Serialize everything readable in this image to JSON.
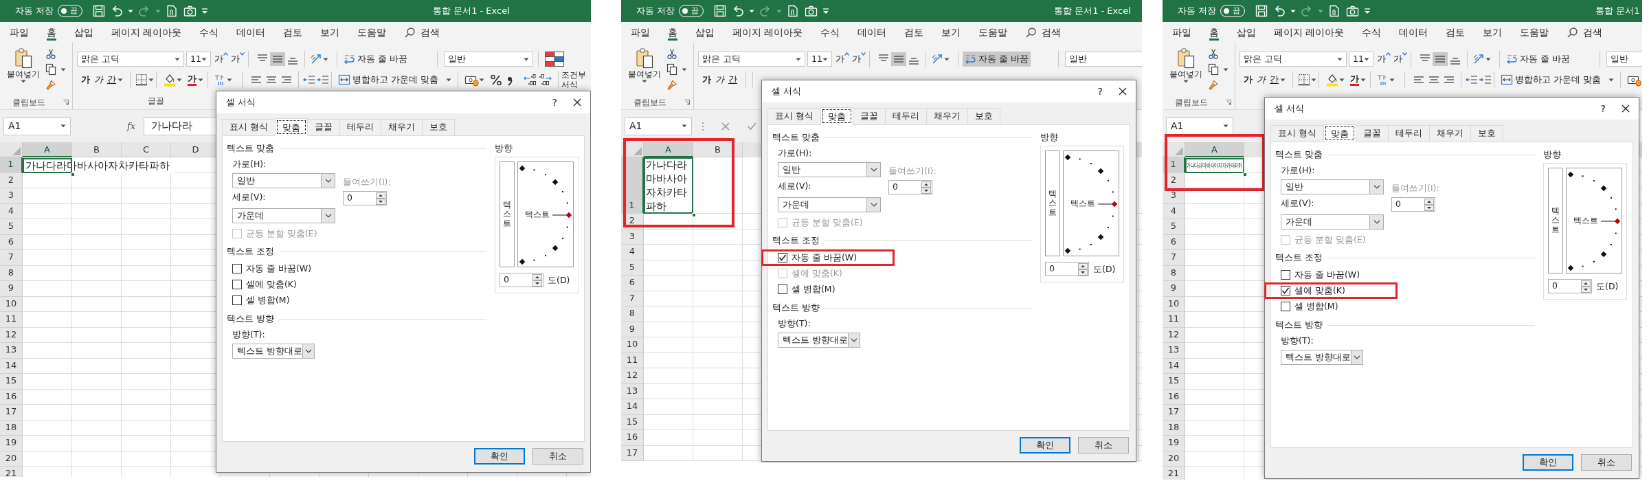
{
  "panels": [
    {
      "title_bar": {
        "autosave": "자동 저장",
        "autosave_toggle": {
          "label": "끔",
          "on": false
        },
        "redo_enabled": false,
        "title": "통합 문서1 - Excel"
      },
      "menu": [
        {
          "label": "파일",
          "selected": false
        },
        {
          "label": "홈",
          "selected": true
        },
        {
          "label": "삽입",
          "selected": false
        },
        {
          "label": "페이지 레이아웃",
          "selected": false
        },
        {
          "label": "수식",
          "selected": false
        },
        {
          "label": "데이터",
          "selected": false
        },
        {
          "label": "검토",
          "selected": false
        },
        {
          "label": "보기",
          "selected": false
        },
        {
          "label": "도움말",
          "selected": false
        }
      ],
      "search": "검색",
      "ribbon": {
        "paste": "붙여넣기",
        "font_name": "맑은 고딕",
        "font_size": "11",
        "grow_font": "가",
        "shrink_font": "가",
        "bold": "가",
        "italic": "가",
        "underline": "간",
        "font_color": "가",
        "middle_align_pressed": true,
        "wrap_text": {
          "label": "자동 줄 바꿈",
          "pressed": false
        },
        "merge": "병합하고 가운데 맞춤",
        "number_format": "일반",
        "conditional_format": "조건부 서식",
        "group_labels": [
          "클립보드",
          "글꼴"
        ]
      },
      "formula_bar": {
        "name_box": "A1",
        "function_label": "fx",
        "formula": "가나다라"
      },
      "sheet": {
        "columns": [
          {
            "label": "A",
            "selected": true
          },
          {
            "label": "B",
            "selected": false
          },
          {
            "label": "C",
            "selected": false
          },
          {
            "label": "D",
            "selected": false
          }
        ],
        "rows": [
          {
            "label": "1",
            "selected": true,
            "cells": [
              {
                "text": "가나다라마바사아자차카타파하",
                "kind": "overflow",
                "active": true,
                "highlighted": false
              }
            ]
          },
          {
            "label": "2",
            "selected": false
          },
          {
            "label": "3",
            "selected": false
          },
          {
            "label": "4",
            "selected": false
          },
          {
            "label": "5",
            "selected": false
          },
          {
            "label": "6",
            "selected": false
          },
          {
            "label": "7",
            "selected": false
          },
          {
            "label": "8",
            "selected": false
          },
          {
            "label": "9",
            "selected": false
          },
          {
            "label": "10",
            "selected": false
          },
          {
            "label": "11",
            "selected": false
          },
          {
            "label": "12",
            "selected": false
          },
          {
            "label": "13",
            "selected": false
          },
          {
            "label": "14",
            "selected": false
          },
          {
            "label": "15",
            "selected": false
          },
          {
            "label": "16",
            "selected": false
          },
          {
            "label": "17",
            "selected": false
          },
          {
            "label": "18",
            "selected": false
          },
          {
            "label": "19",
            "selected": false
          },
          {
            "label": "20",
            "selected": false
          },
          {
            "label": "21",
            "selected": false
          }
        ]
      },
      "dialog": {
        "title": "셀 서식",
        "help": "?",
        "tabs": [
          {
            "label": "표시 형식",
            "selected": false
          },
          {
            "label": "맞춤",
            "selected": true
          },
          {
            "label": "글꼴",
            "selected": false
          },
          {
            "label": "테두리",
            "selected": false
          },
          {
            "label": "채우기",
            "selected": false
          },
          {
            "label": "보호",
            "selected": false
          }
        ],
        "alignment_heading": "텍스트 맞춤",
        "horizontal": {
          "label": "가로(H):",
          "value": "일반"
        },
        "indent": {
          "label": "들여쓰기(I):",
          "value": "0",
          "disabled": true
        },
        "vertical": {
          "label": "세로(V):",
          "value": "가운데"
        },
        "distributed": {
          "label": "균등 분할 맞춤(E)",
          "checked": false,
          "disabled": true
        },
        "control_heading": "텍스트 조정",
        "options": [
          {
            "label": "자동 줄 바꿈(W)",
            "checked": false,
            "disabled": false,
            "highlighted": false
          },
          {
            "label": "셀에 맞춤(K)",
            "checked": false,
            "disabled": false,
            "highlighted": false
          },
          {
            "label": "셀 병합(M)",
            "checked": false,
            "disabled": false,
            "highlighted": false
          }
        ],
        "direction_heading": "텍스트 방향",
        "direction": {
          "label": "방향(T):",
          "value": "텍스트 방향대로"
        },
        "orientation": {
          "label": "방향",
          "vertical_text": "텍스트",
          "dial_text": "텍스트",
          "degrees": "0",
          "degrees_label": "도(D)"
        },
        "buttons": [
          {
            "label": "확인",
            "default": true
          },
          {
            "label": "취소",
            "default": false
          }
        ]
      }
    },
    {
      "title_bar": {
        "autosave": "자동 저장",
        "autosave_toggle": {
          "label": "끔",
          "on": false
        },
        "redo_enabled": false,
        "title": "통합 문서1 - Excel"
      },
      "menu": [
        {
          "label": "파일",
          "selected": false
        },
        {
          "label": "홈",
          "selected": true
        },
        {
          "label": "삽입",
          "selected": false
        },
        {
          "label": "페이지 레이아웃",
          "selected": false
        },
        {
          "label": "수식",
          "selected": false
        },
        {
          "label": "데이터",
          "selected": false
        },
        {
          "label": "검토",
          "selected": false
        },
        {
          "label": "보기",
          "selected": false
        },
        {
          "label": "도움말",
          "selected": false
        }
      ],
      "search": "검색",
      "ribbon": {
        "paste": "붙여넣기",
        "font_name": "맑은 고딕",
        "font_size": "11",
        "grow_font": "가",
        "shrink_font": "가",
        "bold": "가",
        "italic": "가",
        "underline": "간",
        "middle_align_pressed": true,
        "wrap_text": {
          "label": "자동 줄 바꿈",
          "pressed": true
        },
        "number_format": "일반",
        "group_labels": [
          "클립보드"
        ]
      },
      "formula_bar": {
        "name_box": "A1"
      },
      "sheet": {
        "columns": [
          {
            "label": "A",
            "selected": true
          },
          {
            "label": "B",
            "selected": false
          }
        ],
        "rows": [
          {
            "label": "1",
            "selected": true,
            "cells": [
              {
                "text": "가나다라마바사아자차카타파하",
                "kind": "wrap",
                "active": true,
                "highlighted": true
              }
            ]
          },
          {
            "label": "2",
            "selected": false
          },
          {
            "label": "3",
            "selected": false
          },
          {
            "label": "4",
            "selected": false
          },
          {
            "label": "5",
            "selected": false
          },
          {
            "label": "6",
            "selected": false
          },
          {
            "label": "7",
            "selected": false
          },
          {
            "label": "8",
            "selected": false
          },
          {
            "label": "9",
            "selected": false
          },
          {
            "label": "10",
            "selected": false
          },
          {
            "label": "11",
            "selected": false
          },
          {
            "label": "12",
            "selected": false
          },
          {
            "label": "13",
            "selected": false
          },
          {
            "label": "14",
            "selected": false
          },
          {
            "label": "15",
            "selected": false
          },
          {
            "label": "16",
            "selected": false
          },
          {
            "label": "17",
            "selected": false
          }
        ]
      },
      "dialog": {
        "title": "셀 서식",
        "help": "?",
        "tabs": [
          {
            "label": "표시 형식",
            "selected": false
          },
          {
            "label": "맞춤",
            "selected": true
          },
          {
            "label": "글꼴",
            "selected": false
          },
          {
            "label": "테두리",
            "selected": false
          },
          {
            "label": "채우기",
            "selected": false
          },
          {
            "label": "보호",
            "selected": false
          }
        ],
        "alignment_heading": "텍스트 맞춤",
        "horizontal": {
          "label": "가로(H):",
          "value": "일반"
        },
        "indent": {
          "label": "들여쓰기(I):",
          "value": "0",
          "disabled": true
        },
        "vertical": {
          "label": "세로(V):",
          "value": "가운데"
        },
        "distributed": {
          "label": "균등 분할 맞춤(E)",
          "checked": false,
          "disabled": true
        },
        "control_heading": "텍스트 조정",
        "options": [
          {
            "label": "자동 줄 바꿈(W)",
            "checked": true,
            "disabled": false,
            "highlighted": true
          },
          {
            "label": "셀에 맞춤(K)",
            "checked": false,
            "disabled": true,
            "highlighted": false
          },
          {
            "label": "셀 병합(M)",
            "checked": false,
            "disabled": false,
            "highlighted": false
          }
        ],
        "direction_heading": "텍스트 방향",
        "direction": {
          "label": "방향(T):",
          "value": "텍스트 방향대로"
        },
        "orientation": {
          "label": "방향",
          "vertical_text": "텍스트",
          "dial_text": "텍스트",
          "degrees": "0",
          "degrees_label": "도(D)"
        },
        "buttons": [
          {
            "label": "확인",
            "default": true
          },
          {
            "label": "취소",
            "default": false
          }
        ]
      }
    },
    {
      "title_bar": {
        "autosave": "자동 저장",
        "autosave_toggle": {
          "label": "끔",
          "on": false
        },
        "redo_enabled": false,
        "title": "통합 문서1"
      },
      "menu": [
        {
          "label": "파일",
          "selected": false
        },
        {
          "label": "홈",
          "selected": true
        },
        {
          "label": "삽입",
          "selected": false
        },
        {
          "label": "페이지 레이아웃",
          "selected": false
        },
        {
          "label": "수식",
          "selected": false
        },
        {
          "label": "데이터",
          "selected": false
        },
        {
          "label": "검토",
          "selected": false
        },
        {
          "label": "보기",
          "selected": false
        },
        {
          "label": "도움말",
          "selected": false
        }
      ],
      "search": "검색",
      "ribbon": {
        "paste": "붙여넣기",
        "font_name": "맑은 고딕",
        "font_size": "11",
        "grow_font": "가",
        "shrink_font": "가",
        "bold": "가",
        "italic": "가",
        "underline": "간",
        "font_color": "가",
        "middle_align_pressed": true,
        "wrap_text": {
          "label": "자동 줄 바꿈",
          "pressed": false
        },
        "merge": "병합하고 가운데 맞춤",
        "number_format": "일반",
        "group_labels": [
          "클립보드"
        ]
      },
      "formula_bar": {
        "name_box": "A1"
      },
      "sheet": {
        "columns": [
          {
            "label": "A",
            "selected": true
          }
        ],
        "rows": [
          {
            "label": "1",
            "selected": true,
            "cells": [
              {
                "text": "가나다라마바사아자차카타파하",
                "kind": "shrink",
                "active": true,
                "highlighted": true
              }
            ]
          },
          {
            "label": "2",
            "selected": false
          },
          {
            "label": "3",
            "selected": false
          },
          {
            "label": "4",
            "selected": false
          },
          {
            "label": "5",
            "selected": false
          },
          {
            "label": "6",
            "selected": false
          },
          {
            "label": "7",
            "selected": false
          },
          {
            "label": "8",
            "selected": false
          },
          {
            "label": "9",
            "selected": false
          },
          {
            "label": "10",
            "selected": false
          },
          {
            "label": "11",
            "selected": false
          },
          {
            "label": "12",
            "selected": false
          },
          {
            "label": "13",
            "selected": false
          },
          {
            "label": "14",
            "selected": false
          },
          {
            "label": "15",
            "selected": false
          },
          {
            "label": "16",
            "selected": false
          },
          {
            "label": "17",
            "selected": false
          },
          {
            "label": "18",
            "selected": false
          },
          {
            "label": "19",
            "selected": false
          },
          {
            "label": "20",
            "selected": false
          },
          {
            "label": "21",
            "selected": false
          }
        ]
      },
      "dialog": {
        "title": "셀 서식",
        "help": "?",
        "tabs": [
          {
            "label": "표시 형식",
            "selected": false
          },
          {
            "label": "맞춤",
            "selected": true
          },
          {
            "label": "글꼴",
            "selected": false
          },
          {
            "label": "테두리",
            "selected": false
          },
          {
            "label": "채우기",
            "selected": false
          },
          {
            "label": "보호",
            "selected": false
          }
        ],
        "alignment_heading": "텍스트 맞춤",
        "horizontal": {
          "label": "가로(H):",
          "value": "일반"
        },
        "indent": {
          "label": "들여쓰기(I):",
          "value": "0",
          "disabled": true
        },
        "vertical": {
          "label": "세로(V):",
          "value": "가운데"
        },
        "distributed": {
          "label": "균등 분할 맞춤(E)",
          "checked": false,
          "disabled": true
        },
        "control_heading": "텍스트 조정",
        "options": [
          {
            "label": "자동 줄 바꿈(W)",
            "checked": false,
            "disabled": false,
            "highlighted": false
          },
          {
            "label": "셀에 맞춤(K)",
            "checked": true,
            "disabled": false,
            "highlighted": true
          },
          {
            "label": "셀 병합(M)",
            "checked": false,
            "disabled": false,
            "highlighted": false
          }
        ],
        "direction_heading": "텍스트 방향",
        "direction": {
          "label": "방향(T):",
          "value": "텍스트 방향대로"
        },
        "orientation": {
          "label": "방향",
          "vertical_text": "텍스트",
          "dial_text": "텍스트",
          "degrees": "0",
          "degrees_label": "도(D)"
        },
        "buttons": [
          {
            "label": "확인",
            "default": true
          },
          {
            "label": "취소",
            "default": false
          }
        ]
      }
    }
  ]
}
